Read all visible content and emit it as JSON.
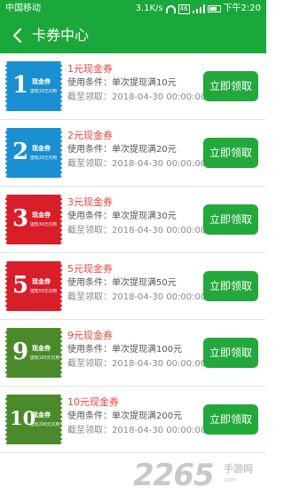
{
  "status_bar": {
    "carrier": "中国移动",
    "speed": "3.1K/s",
    "network": "46",
    "time": "下午2:20"
  },
  "header": {
    "title": "卡券中心",
    "back_icon": "back-arrow-icon"
  },
  "coupons": [
    {
      "amount": "1",
      "name": "1元现金券",
      "condition": "使用条件：单次提现满10元",
      "expiry": "截至领取：2018-04-30 00:00:00",
      "ticket_label": "现金券",
      "ticket_desc": "提现10元可用",
      "color": "#1a8fd1",
      "button": "立即领取"
    },
    {
      "amount": "2",
      "name": "2元现金券",
      "condition": "使用条件：单次提现满20元",
      "expiry": "截至领取：2018-04-30 00:00:00",
      "ticket_label": "现金券",
      "ticket_desc": "提现20元可用",
      "color": "#1a8fd1",
      "button": "立即领取"
    },
    {
      "amount": "3",
      "name": "3元现金券",
      "condition": "使用条件：单次提现满30元",
      "expiry": "截至领取：2018-04-30 00:00:00",
      "ticket_label": "现金券",
      "ticket_desc": "提现30元可用",
      "color": "#d81e28",
      "button": "立即领取"
    },
    {
      "amount": "5",
      "name": "5元现金券",
      "condition": "使用条件：单次提现满50元",
      "expiry": "截至领取：2018-04-30 00:00:00",
      "ticket_label": "现金券",
      "ticket_desc": "提现50元可用",
      "color": "#d81e28",
      "button": "立即领取"
    },
    {
      "amount": "9",
      "name": "9元现金券",
      "condition": "使用条件：单次提现满100元",
      "expiry": "截至领取：2018-04-30 00:00:00",
      "ticket_label": "现金券",
      "ticket_desc": "提现100元可用",
      "color": "#4a8a2a",
      "button": "立即领取"
    },
    {
      "amount": "10",
      "name": "10元现金券",
      "condition": "使用条件：单次提现满200元",
      "expiry": "截至领取：2018-04-30 00:00:00",
      "ticket_label": "现金券",
      "ticket_desc": "提现200元可用",
      "color": "#4a8a2a",
      "button": "立即领取"
    }
  ],
  "watermark": {
    "number": "2265",
    "suffix": "com",
    "name": "手游网"
  },
  "colors": {
    "primary": "#1aa83a",
    "button": "#23a83c",
    "coupon_name": "#e9463e"
  }
}
